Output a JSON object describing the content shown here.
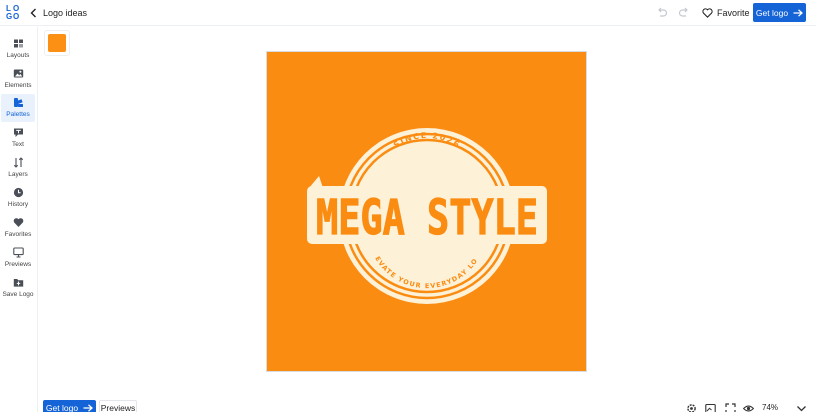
{
  "header": {
    "back_label": "Logo ideas",
    "favorite_label": "Favorite",
    "get_logo_label": "Get logo"
  },
  "brand": {
    "logo_letters": [
      "L",
      "O",
      "G",
      "O"
    ]
  },
  "sidebar": {
    "items": [
      {
        "label": "Layouts",
        "icon": "layouts-icon"
      },
      {
        "label": "Elements",
        "icon": "image-icon"
      },
      {
        "label": "Palettes",
        "icon": "palette-icon",
        "active": true
      },
      {
        "label": "Text",
        "icon": "text-icon"
      },
      {
        "label": "Layers",
        "icon": "layers-icon"
      },
      {
        "label": "History",
        "icon": "clock-icon"
      },
      {
        "label": "Favorites",
        "icon": "heart-icon"
      },
      {
        "label": "Previews",
        "icon": "monitor-icon"
      },
      {
        "label": "Save Logo",
        "icon": "save-folder-icon"
      }
    ]
  },
  "palette": {
    "selected_color": "#fb9015"
  },
  "logo_design": {
    "title": "MEGA STYLE",
    "top_text": "SINCE 2026",
    "bottom_text": "ELEVATE YOUR EVERYDAY LOOK",
    "background_color": "#fb8c12",
    "badge_color": "#fdf1d8"
  },
  "footer": {
    "get_logo_label": "Get logo",
    "previews_label": "Previews",
    "zoom": "74%"
  },
  "colors": {
    "accent": "#1463d7",
    "active_bg": "#e8f1fc"
  }
}
